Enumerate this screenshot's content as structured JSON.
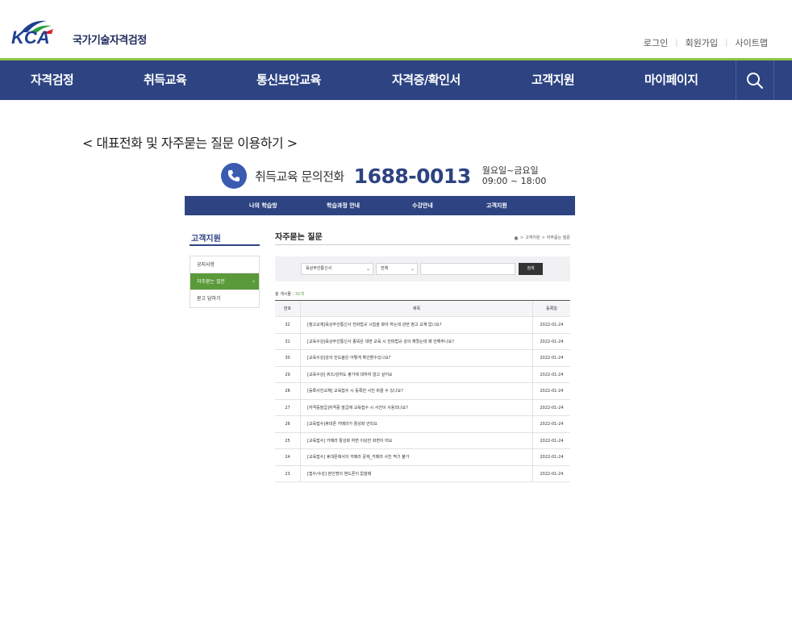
{
  "header": {
    "logo_letters": "KCA",
    "logo_text": "국가기술자격검정",
    "util_links": [
      "로그인",
      "회원가입",
      "사이트맵"
    ]
  },
  "nav": {
    "items": [
      "자격검정",
      "취득교육",
      "통신보안교육",
      "자격증/확인서",
      "고객지원",
      "마이페이지"
    ],
    "search_icon": "search-icon"
  },
  "content": {
    "heading": "< 대표전화 및 자주묻는 질문 이용하기 >",
    "call": {
      "label": "취득교육 문의전화",
      "number": "1688-0013",
      "hours_line1": "월요일~금요일",
      "hours_line2": "09:00 ~ 18:00"
    }
  },
  "shot": {
    "nav": [
      "나의 학습방",
      "학습과정 안내",
      "수강안내",
      "고객지원"
    ],
    "side_title": "고객지원",
    "side_menu": [
      "공지사항",
      "자주묻는 질문",
      "묻고 답하기"
    ],
    "page_title": "자주묻는 질문",
    "breadcrumb": [
      "고객지원",
      ">",
      "자주묻는 질문"
    ],
    "search": {
      "category": "육상무선통신사",
      "scope": "전체",
      "button": "검색"
    },
    "total_label": "총 게시물 : ",
    "total_value": "32개",
    "table": {
      "headers": [
        "번호",
        "제목",
        "등록일"
      ],
      "rows": [
        {
          "no": "32",
          "title": "[참고교재]육상무선통신사 전파법규 시험을 봐야 하는데 관련 참고 교재 없나요?",
          "date": "2022-01-24"
        },
        {
          "no": "31",
          "title": "[교육수강]육상무선통신사 종목은 대면 교육 시 전파법규 강의 해줬는데 왜 안해주나요?",
          "date": "2022-01-24"
        },
        {
          "no": "30",
          "title": "[교육수강]강의 진도율은 어떻게 확인할수있나요?",
          "date": "2022-01-24"
        },
        {
          "no": "29",
          "title": "[교육수강] 퀴즈/성취도 평가에 대하여 알고 싶어요",
          "date": "2022-01-24"
        },
        {
          "no": "28",
          "title": "[등록사진교체] 교육접수 시 등록한 사진 바꿀 수 있나요?",
          "date": "2022-01-24"
        },
        {
          "no": "27",
          "title": "[자격증발급]자격증 발급에 교육접수 시 사진이 사용되나요?",
          "date": "2022-01-24"
        },
        {
          "no": "26",
          "title": "[교육접수]휴대폰 카메라가 활성화 안되요",
          "date": "2022-01-24"
        },
        {
          "no": "25",
          "title": "[교육접수] 카메라 활성화 하면 이상한 화면이 떠요",
          "date": "2022-01-24"
        },
        {
          "no": "24",
          "title": "[교육접수] 휴대폰에서의 카메라 문제_카메라 사진 찍기 불가",
          "date": "2022-01-24"
        },
        {
          "no": "23",
          "title": "[접수/수강] 본인명의 핸드폰이 없을때",
          "date": "2022-01-24"
        }
      ]
    }
  },
  "colors": {
    "navy": "#2d4382",
    "green": "#8cc63f",
    "active_green": "#5a9a3a"
  }
}
